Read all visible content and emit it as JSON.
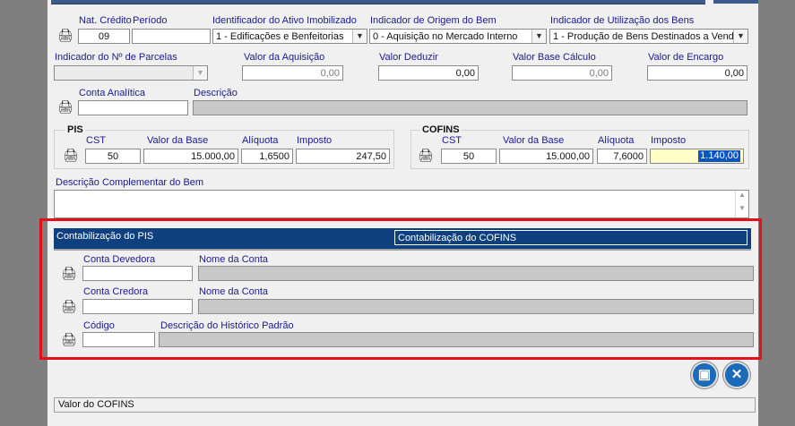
{
  "row1": {
    "nat_credito_label": "Nat. Crédito",
    "nat_credito_value": "09",
    "periodo_label": "Período",
    "periodo_value": "",
    "ativo_label": "Identificador do Ativo Imobilizado",
    "ativo_value": "1 - Edificações e Benfeitorias",
    "origem_label": "Indicador de Origem do Bem",
    "origem_value": "0 - Aquisição no Mercado Interno",
    "utilizacao_label": "Indicador de Utilização dos Bens",
    "utilizacao_value": "1 - Produção de Bens Destinados a Vend"
  },
  "row2": {
    "parcelas_label": "Indicador do Nº de Parcelas",
    "parcelas_value": "",
    "aquisicao_label": "Valor da Aquisição",
    "aquisicao_value": "0,00",
    "deduzir_label": "Valor Deduzir",
    "deduzir_value": "0,00",
    "base_calculo_label": "Valor Base Cálculo",
    "base_calculo_value": "0,00",
    "encargo_label": "Valor de Encargo",
    "encargo_value": "0,00"
  },
  "row3": {
    "conta_analitica_label": "Conta Analítica",
    "conta_analitica_value": "",
    "descricao_label": "Descrição",
    "descricao_value": ""
  },
  "pis": {
    "title": "PIS",
    "cst_label": "CST",
    "cst_value": "50",
    "base_label": "Valor da Base",
    "base_value": "15.000,00",
    "aliquota_label": "Alíquota",
    "aliquota_value": "1,6500",
    "imposto_label": "Imposto",
    "imposto_value": "247,50"
  },
  "cofins": {
    "title": "COFINS",
    "cst_label": "CST",
    "cst_value": "50",
    "base_label": "Valor da Base",
    "base_value": "15.000,00",
    "aliquota_label": "Alíquota",
    "aliquota_value": "7,6000",
    "imposto_label": "Imposto",
    "imposto_value": "1.140,00"
  },
  "complementar": {
    "label": "Descrição Complementar do Bem",
    "value": ""
  },
  "tabs": {
    "pis_label": "Contabilização do PIS",
    "cofins_label": "Contabilização do COFINS"
  },
  "contab": {
    "devedora_label": "Conta Devedora",
    "devedora_value": "",
    "nome_conta_label_1": "Nome da Conta",
    "credora_label": "Conta Credora",
    "credora_value": "",
    "nome_conta_label_2": "Nome da Conta",
    "codigo_label": "Código",
    "codigo_value": "",
    "historico_label": "Descrição do Histórico Padrão"
  },
  "icons": {
    "printer": "printer-icon",
    "save": "save-icon",
    "close": "close-icon"
  },
  "colors": {
    "tab_bar": "#0e3f7e",
    "highlight_border": "#e3101a",
    "label_text": "#1a1a8c"
  },
  "status": {
    "text": "Valor do COFINS"
  }
}
